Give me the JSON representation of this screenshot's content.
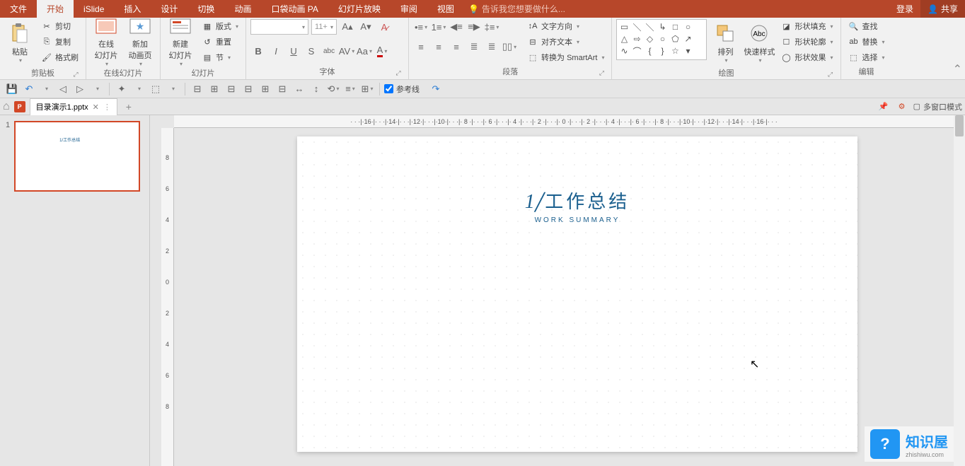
{
  "menu": {
    "tabs": [
      "文件",
      "开始",
      "iSlide",
      "插入",
      "设计",
      "切换",
      "动画",
      "口袋动画 PA",
      "幻灯片放映",
      "审阅",
      "视图"
    ],
    "active_index": 1,
    "tell_me": "告诉我您想要做什么...",
    "login": "登录",
    "share": "共享"
  },
  "ribbon": {
    "clipboard": {
      "label": "剪贴板",
      "paste": "粘贴",
      "cut": "剪切",
      "copy": "复制",
      "formatpainter": "格式刷"
    },
    "online": {
      "label": "在线幻灯片",
      "onlineslide": "在线\n幻灯片",
      "newanim": "新加\n动画页"
    },
    "slides": {
      "label": "幻灯片",
      "newslide": "新建\n幻灯片",
      "layout": "版式",
      "reset": "重置",
      "section": "节"
    },
    "font": {
      "label": "字体",
      "size": "11+"
    },
    "paragraph": {
      "label": "段落",
      "textdir": "文字方向",
      "align": "对齐文本",
      "smartart": "转换为 SmartArt"
    },
    "drawing": {
      "label": "绘图",
      "arrange": "排列",
      "quickstyle": "快速样式",
      "shapefill": "形状填充",
      "shapeoutline": "形状轮廓",
      "shapeeffects": "形状效果"
    },
    "editing": {
      "label": "编辑",
      "find": "查找",
      "replace": "替换",
      "select": "选择"
    }
  },
  "qat": {
    "guides": "参考线"
  },
  "doc": {
    "filename": "目录演示1.pptx",
    "multiwindow": "多窗口模式"
  },
  "thumb": {
    "num": "1"
  },
  "slide": {
    "num": "1",
    "title_cn": "工作总结",
    "title_en": "WORK SUMMARY"
  },
  "ruler_h": "· · ·|·16·|· · ·|·14·|· · ·|·12·|· · ·|·10·|· · ·|· 8 ·|· · ·|· 6 ·|· · ·|· 4 ·|· · ·|· 2 ·|· · ·|· 0 ·|· · ·|· 2 ·|· · ·|· 4 ·|· · ·|· 6 ·|· · ·|· 8 ·|· · ·|·10·|· · ·|·12·|· · ·|·14·|· · ·|·16·|· · ·",
  "ruler_v": [
    "8",
    "6",
    "4",
    "2",
    "0",
    "2",
    "4",
    "6",
    "8"
  ],
  "watermark": {
    "cn": "知识屋",
    "en": "zhishiwu.com",
    "logo": "?"
  }
}
